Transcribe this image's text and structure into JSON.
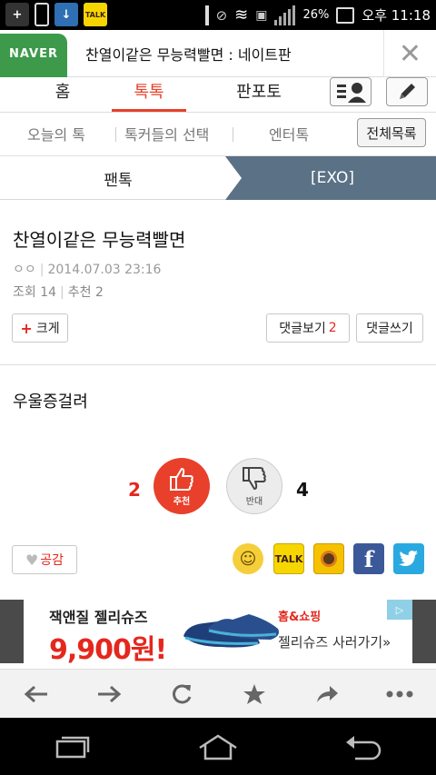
{
  "status_bar": {
    "battery": "26%",
    "time": "오후 11:18",
    "talk_label": "TALK"
  },
  "browser": {
    "naver_tab": "NAVER",
    "page_title": "찬열이같은 무능력빨면 : 네이트판",
    "close": "✕"
  },
  "main_nav": {
    "home": "홈",
    "toktok": "톡톡",
    "panpo": "판포토"
  },
  "sub_nav": {
    "today": "오늘의 톡",
    "choice": "톡커들의 선택",
    "enter": "엔터톡",
    "all_list": "전체목록"
  },
  "tabs": {
    "fan": "팬톡",
    "exo": "[EXO]"
  },
  "post": {
    "title": "찬열이같은 무능력빨면",
    "author": "ㅇㅇ",
    "date": "2014.07.03 23:16",
    "views": "조회 14",
    "recommends": "추천 2",
    "body": "우울증걸려"
  },
  "buttons": {
    "bigger": "크게",
    "view_comments": "댓글보기",
    "comment_count": "2",
    "write_comment": "댓글쓰기"
  },
  "votes": {
    "up_count": "2",
    "up_label": "추천",
    "down_count": "4",
    "down_label": "반대"
  },
  "share": {
    "empathy": "공감",
    "talk": "TALK"
  },
  "ad": {
    "line1": "잭앤질 젤리슈즈",
    "price": "9,900원!",
    "brand": "홈&쇼핑",
    "line2": "젤리슈즈 사러가기»"
  },
  "colors": {
    "accent": "#e8402a",
    "tab_active": "#5b7186",
    "naver_green": "#3d9a4a"
  }
}
